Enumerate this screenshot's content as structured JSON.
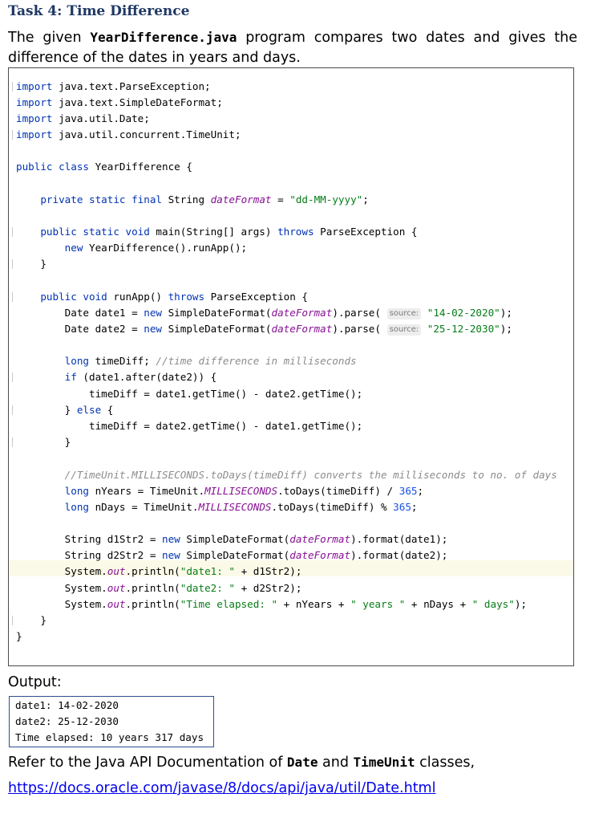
{
  "heading": "Task 4: Time Difference",
  "intro": {
    "part1": "The given ",
    "filename": "YearDifference.java",
    "part2": " program compares two dates and gives the difference of the dates in years and days."
  },
  "code": {
    "l1_kw": "import",
    "l1_rest": " java.text.ParseException;",
    "l2_kw": "import",
    "l2_rest": " java.text.SimpleDateFormat;",
    "l3_kw": "import",
    "l3_rest": " java.util.Date;",
    "l4_kw": "import",
    "l4_rest": " java.util.concurrent.TimeUnit;",
    "l6_kw": "public class",
    "l6_rest": " YearDifference {",
    "l8_kw": "private static final",
    "l8_a": " String ",
    "l8_fld": "dateFormat",
    "l8_b": " = ",
    "l8_str": "\"dd-MM-yyyy\"",
    "l8_c": ";",
    "l10_kw1": "public static void",
    "l10_a": " main(String[] args) ",
    "l10_kw2": "throws",
    "l10_b": " ParseException {",
    "l11_kw": "new",
    "l11_rest": " YearDifference().runApp();",
    "l12": "}",
    "l14_kw1": "public void",
    "l14_a": " runApp() ",
    "l14_kw2": "throws",
    "l14_b": " ParseException {",
    "l15_a": "Date date1 = ",
    "l15_kw": "new",
    "l15_b": " SimpleDateFormat(",
    "l15_fld": "dateFormat",
    "l15_c": ").parse(",
    "l15_hint": "source:",
    "l15_str": "\"14-02-2020\"",
    "l15_d": ");",
    "l16_a": "Date date2 = ",
    "l16_kw": "new",
    "l16_b": " SimpleDateFormat(",
    "l16_fld": "dateFormat",
    "l16_c": ").parse(",
    "l16_hint": "source:",
    "l16_str": "\"25-12-2030\"",
    "l16_d": ");",
    "l18_kw": "long",
    "l18_a": " timeDiff; ",
    "l18_cmt": "//time difference in milliseconds",
    "l19_kw": "if",
    "l19_rest": " (date1.after(date2)) {",
    "l20": "timeDiff = date1.getTime() - date2.getTime();",
    "l21_a": "} ",
    "l21_kw": "else",
    "l21_b": " {",
    "l22": "timeDiff = date2.getTime() - date1.getTime();",
    "l23": "}",
    "l25_cmt": "//TimeUnit.MILLISECONDS.toDays(timeDiff) converts the milliseconds to no. of days",
    "l26_kw": "long",
    "l26_a": " nYears = TimeUnit.",
    "l26_fld": "MILLISECONDS",
    "l26_b": ".toDays(timeDiff) / ",
    "l26_num": "365",
    "l26_c": ";",
    "l27_kw": "long",
    "l27_a": " nDays = TimeUnit.",
    "l27_fld": "MILLISECONDS",
    "l27_b": ".toDays(timeDiff) % ",
    "l27_num": "365",
    "l27_c": ";",
    "l29_a": "String d1Str2 = ",
    "l29_kw": "new",
    "l29_b": " SimpleDateFormat(",
    "l29_fld": "dateFormat",
    "l29_c": ").format(date1);",
    "l30_a": "String d2Str2 = ",
    "l30_kw": "new",
    "l30_b": " SimpleDateFormat(",
    "l30_fld": "dateFormat",
    "l30_c": ").format(date2);",
    "l31_a": "System.",
    "l31_fld": "out",
    "l31_b": ".println(",
    "l31_str": "\"date1: \"",
    "l31_c": " + d1Str2);",
    "l32_a": "System.",
    "l32_fld": "out",
    "l32_b": ".println(",
    "l32_str": "\"date2: \"",
    "l32_c": " + d2Str2);",
    "l33_a": "System.",
    "l33_fld": "out",
    "l33_b": ".println(",
    "l33_str1": "\"Time elapsed: \"",
    "l33_c": " + nYears + ",
    "l33_str2": "\" years \"",
    "l33_d": " + nDays + ",
    "l33_str3": "\" days\"",
    "l33_e": ");",
    "l34": "}",
    "l35": "}"
  },
  "output": {
    "label": "Output:",
    "lines": [
      "date1: 14-02-2020",
      "date2: 25-12-2030",
      "Time elapsed: 10 years 317 days"
    ]
  },
  "refer": {
    "part1": "Refer to the Java API Documentation of ",
    "class1": "Date",
    "part2": " and ",
    "class2": "TimeUnit",
    "part3": " classes,"
  },
  "link": "https://docs.oracle.com/javase/8/docs/api/java/util/Date.html"
}
